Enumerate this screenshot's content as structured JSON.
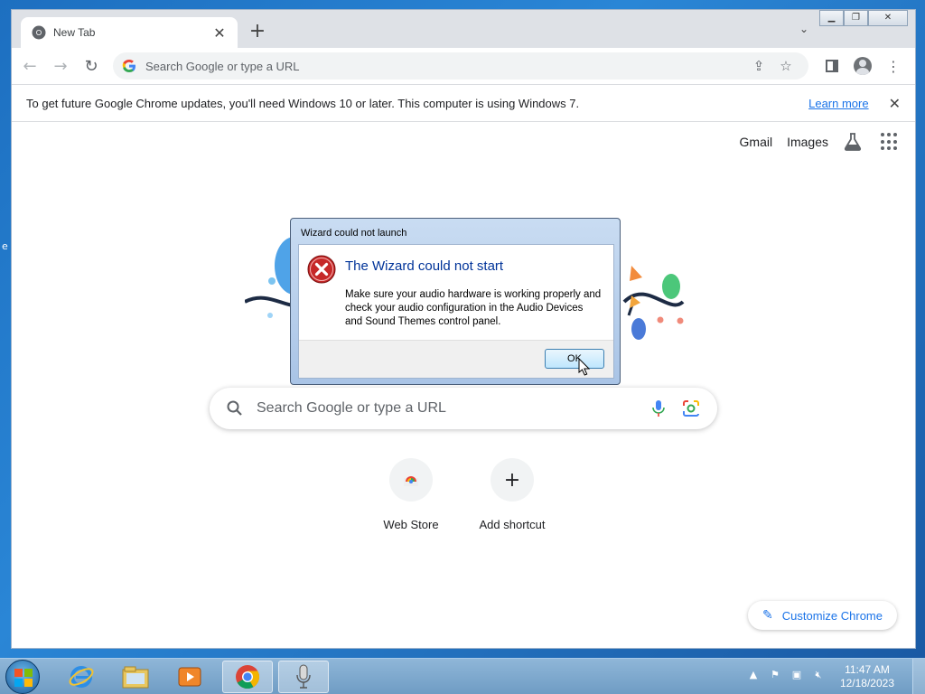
{
  "browser": {
    "tab_title": "New Tab",
    "omnibox_placeholder": "Search Google or type a URL",
    "infobar": {
      "message": "To get future Google Chrome updates, you'll need Windows 10 or later. This computer is using Windows 7.",
      "link": "Learn more"
    }
  },
  "ntp": {
    "links": [
      "Gmail",
      "Images"
    ],
    "search_placeholder": "Search Google or type a URL",
    "shortcuts": [
      {
        "label": "Web Store",
        "icon": "web-store-icon"
      },
      {
        "label": "Add shortcut",
        "icon": "plus-icon",
        "glyph": "+"
      }
    ],
    "customize_label": "Customize Chrome"
  },
  "dialog": {
    "title": "Wizard could not launch",
    "heading": "The Wizard could not start",
    "message": "Make sure your audio hardware is working properly and check your audio configuration in the Audio Devices and Sound Themes control panel.",
    "ok_label": "OK"
  },
  "desktop": {
    "edge_text": "e"
  },
  "taskbar": {
    "apps": [
      "internet-explorer-icon",
      "file-explorer-icon",
      "media-player-icon",
      "chrome-icon",
      "microphone-icon"
    ],
    "active_app": "chrome-icon",
    "clock": {
      "time": "11:47 AM",
      "date": "12/18/2023"
    }
  },
  "colors": {
    "accent": "#1a73e8",
    "dialog_heading": "#003399",
    "error_red": "#c62828"
  }
}
